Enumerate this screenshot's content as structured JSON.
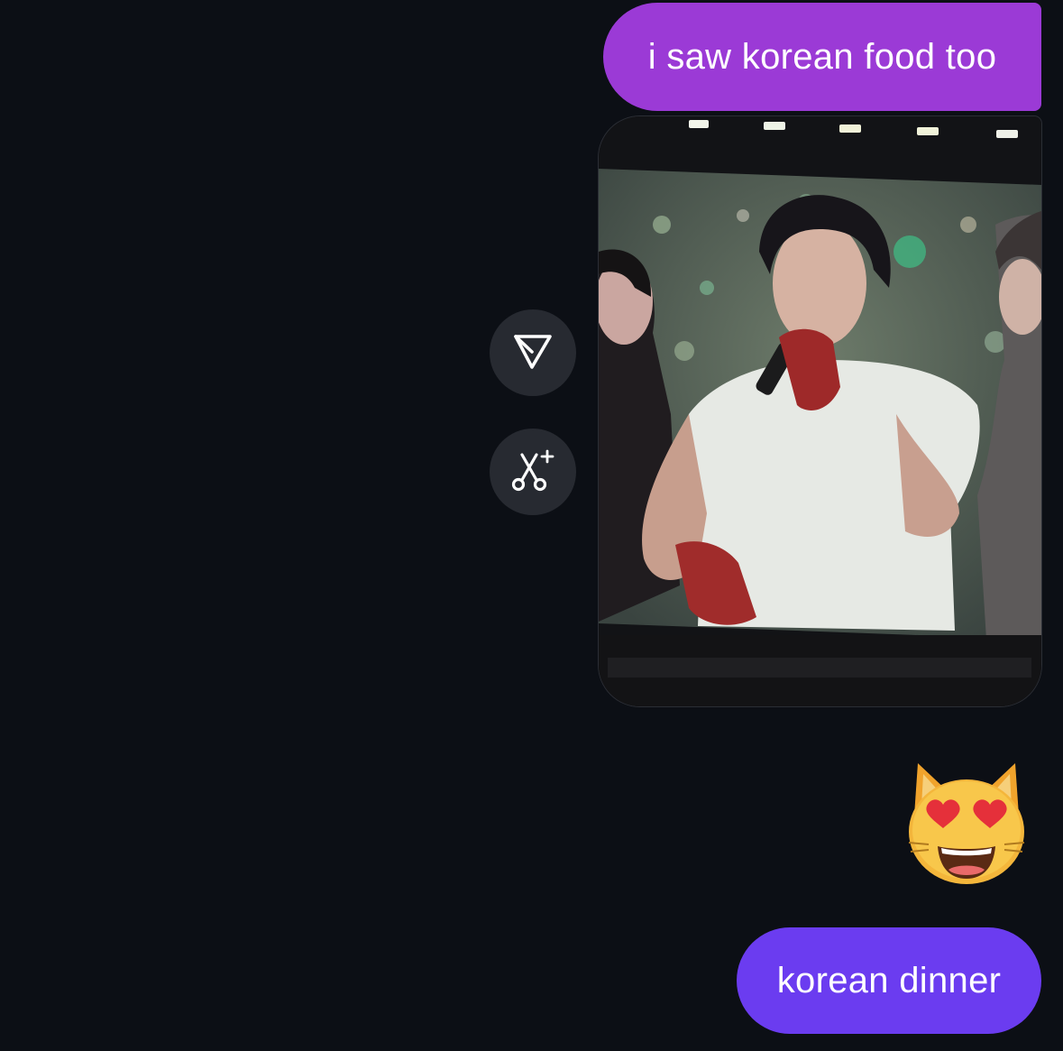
{
  "messages": [
    {
      "type": "text",
      "text": "i saw korean food too",
      "color": "#9b3ad6"
    },
    {
      "type": "image",
      "alt": "concert photo"
    },
    {
      "type": "emoji",
      "emoji": "smiling-cat-heart-eyes"
    },
    {
      "type": "text",
      "text": "korean dinner",
      "color": "#6b3cf0"
    }
  ],
  "actions": {
    "share_icon": "paper-plane-icon",
    "remix_icon": "scissors-sparkle-icon"
  },
  "colors": {
    "background": "#0c0f15",
    "button_bg": "#272a31",
    "bubble_purple": "#9b3ad6",
    "bubble_violet": "#6b3cf0"
  }
}
